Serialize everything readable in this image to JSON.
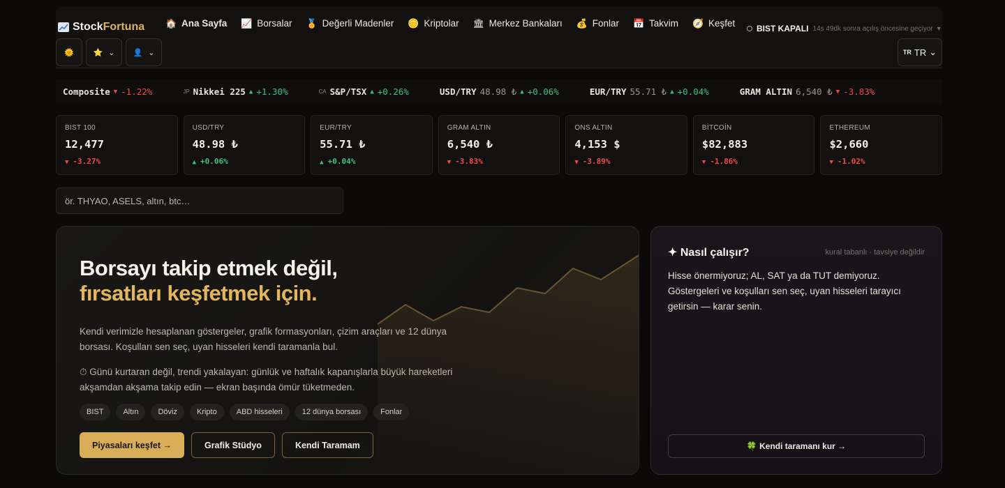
{
  "brand": {
    "part1": "Stock",
    "part2": "Fortuna",
    "icon": "chart-line-icon"
  },
  "nav": [
    {
      "label": "Ana Sayfa",
      "icon": "🏠"
    },
    {
      "label": "Borsalar",
      "icon": "📈"
    },
    {
      "label": "Değerli Madenler",
      "icon": "🏅"
    },
    {
      "label": "Kriptolar",
      "icon": "🪙"
    },
    {
      "label": "Merkez Bankaları",
      "icon": "🏛"
    },
    {
      "label": "Fonlar",
      "icon": "💰"
    },
    {
      "label": "Takvim",
      "icon": "📅"
    },
    {
      "label": "Keşfet",
      "icon": "🧭"
    }
  ],
  "market_status": {
    "label": "BIST KAPALI",
    "sub": "14s 49dk sonra açılış öncesine geçiyor"
  },
  "controls": {
    "theme_icon": "🌞",
    "fav_icon": "⭐",
    "user_icon": "👤"
  },
  "lang": {
    "flag": "TR",
    "label": "TR"
  },
  "ticker": [
    {
      "cc": "",
      "name": "Composite",
      "price": "",
      "dir": "down",
      "change": "-1.22%"
    },
    {
      "cc": "JP",
      "name": "Nikkei 225",
      "price": "",
      "dir": "up",
      "change": "+1.30%"
    },
    {
      "cc": "CA",
      "name": "S&P/TSX",
      "price": "",
      "dir": "up",
      "change": "+0.26%"
    },
    {
      "cc": "",
      "name": "USD/TRY",
      "price": "48.98 ₺",
      "dir": "up",
      "change": "+0.06%"
    },
    {
      "cc": "",
      "name": "EUR/TRY",
      "price": "55.71 ₺",
      "dir": "up",
      "change": "+0.04%"
    },
    {
      "cc": "",
      "name": "GRAM ALTIN",
      "price": "6,540 ₺",
      "dir": "down",
      "change": "-3.83%"
    }
  ],
  "cards": [
    {
      "label": "BIST 100",
      "value": "12,477",
      "dir": "down",
      "change": "-3.27%"
    },
    {
      "label": "USD/TRY",
      "value": "48.98 ₺",
      "dir": "up",
      "change": "+0.06%"
    },
    {
      "label": "EUR/TRY",
      "value": "55.71 ₺",
      "dir": "up",
      "change": "+0.04%"
    },
    {
      "label": "GRAM ALTIN",
      "value": "6,540 ₺",
      "dir": "down",
      "change": "-3.83%"
    },
    {
      "label": "ONS ALTIN",
      "value": "4,153 $",
      "dir": "down",
      "change": "-3.89%"
    },
    {
      "label": "BİTCOİN",
      "value": "$82,883",
      "dir": "down",
      "change": "-1.86%"
    },
    {
      "label": "ETHEREUM",
      "value": "$2,660",
      "dir": "down",
      "change": "-1.02%"
    }
  ],
  "search": {
    "placeholder": "ör. THYAO, ASELS, altın, btc…"
  },
  "hero": {
    "title_l1": "Borsayı takip etmek değil,",
    "title_l2": "fırsatları keşfetmek için.",
    "p1": "Kendi verimizle hesaplanan göstergeler, grafik formasyonları, çizim araçları ve 12 dünya borsası. Koşulları sen seç, uyan hisseleri kendi taramanla bul.",
    "p2": "⏱ Günü kurtaran değil, trendi yakalayan: günlük ve haftalık kapanışlarla büyük hareketleri akşamdan akşama takip edin — ekran başında ömür tüketmeden.",
    "tags": [
      "BIST",
      "Altın",
      "Döviz",
      "Kripto",
      "ABD hisseleri",
      "12 dünya borsası",
      "Fonlar"
    ],
    "btn_primary": "Piyasaları keşfet →",
    "btn_studio": "Grafik Stüdyo",
    "btn_scan": "Kendi Taramam"
  },
  "how": {
    "title": "✦ Nasıl çalışır?",
    "tagline": "kural tabanlı · tavsiye değildir",
    "text": "Hisse önermiyoruz; AL, SAT ya da TUT demiyoruz. Göstergeleri ve koşulları sen seç, uyan hisseleri tarayıcı getirsin — karar senin.",
    "cta": "🍀 Kendi taramanı kur →"
  }
}
